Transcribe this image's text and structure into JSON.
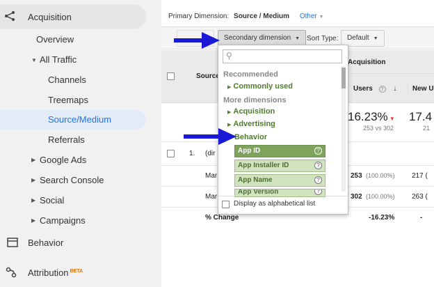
{
  "sidebar": {
    "acquisition": "Acquisition",
    "overview": "Overview",
    "all_traffic": "All Traffic",
    "channels": "Channels",
    "treemaps": "Treemaps",
    "source_medium": "Source/Medium",
    "referrals": "Referrals",
    "google_ads": "Google Ads",
    "search_console": "Search Console",
    "social": "Social",
    "campaigns": "Campaigns",
    "behavior": "Behavior",
    "attribution": "Attribution",
    "beta": "BETA"
  },
  "toolbar": {
    "primary_label": "Primary Dimension:",
    "primary_value": "Source / Medium",
    "other": "Other",
    "secondary_dimension": "Secondary dimension",
    "sort_type_label": "Sort Type:",
    "sort_type_value": "Default"
  },
  "table": {
    "header_source": "Source",
    "acquisition_band": "Acquisition",
    "col_users": "Users",
    "col_new_users": "New Us",
    "summary": {
      "users_pct": "16.23%",
      "users_vs": "253 vs 302",
      "new_users_partial": "17.4",
      "new_users_vs_partial": "21"
    },
    "rows": [
      {
        "num": "1.",
        "label": "(dir",
        "users": "",
        "pct": "",
        "new": ""
      },
      {
        "num": "",
        "label": "Mar",
        "users": "253",
        "pct": "(100.00%)",
        "new": "217 ("
      },
      {
        "num": "",
        "label": "Mar",
        "users": "302",
        "pct": "(100.00%)",
        "new": "263 ("
      },
      {
        "num": "",
        "label": "% Change",
        "users": "-16.23%",
        "pct": "",
        "new": "-"
      }
    ]
  },
  "dropdown": {
    "search_placeholder": "",
    "recommended": "Recommended",
    "commonly_used": "Commonly used",
    "more_dimensions": "More dimensions",
    "acquisition": "Acquisition",
    "advertising": "Advertising",
    "behavior": "Behavior",
    "subitems": [
      "App ID",
      "App Installer ID",
      "App Name",
      "App Version"
    ],
    "footer": "Display as alphabetical list"
  },
  "colors": {
    "arrow": "#1a1ad6",
    "active_nav": "#1a73e8",
    "dimension_green": "#4f7d2f",
    "selected_green": "#7ea35a"
  }
}
